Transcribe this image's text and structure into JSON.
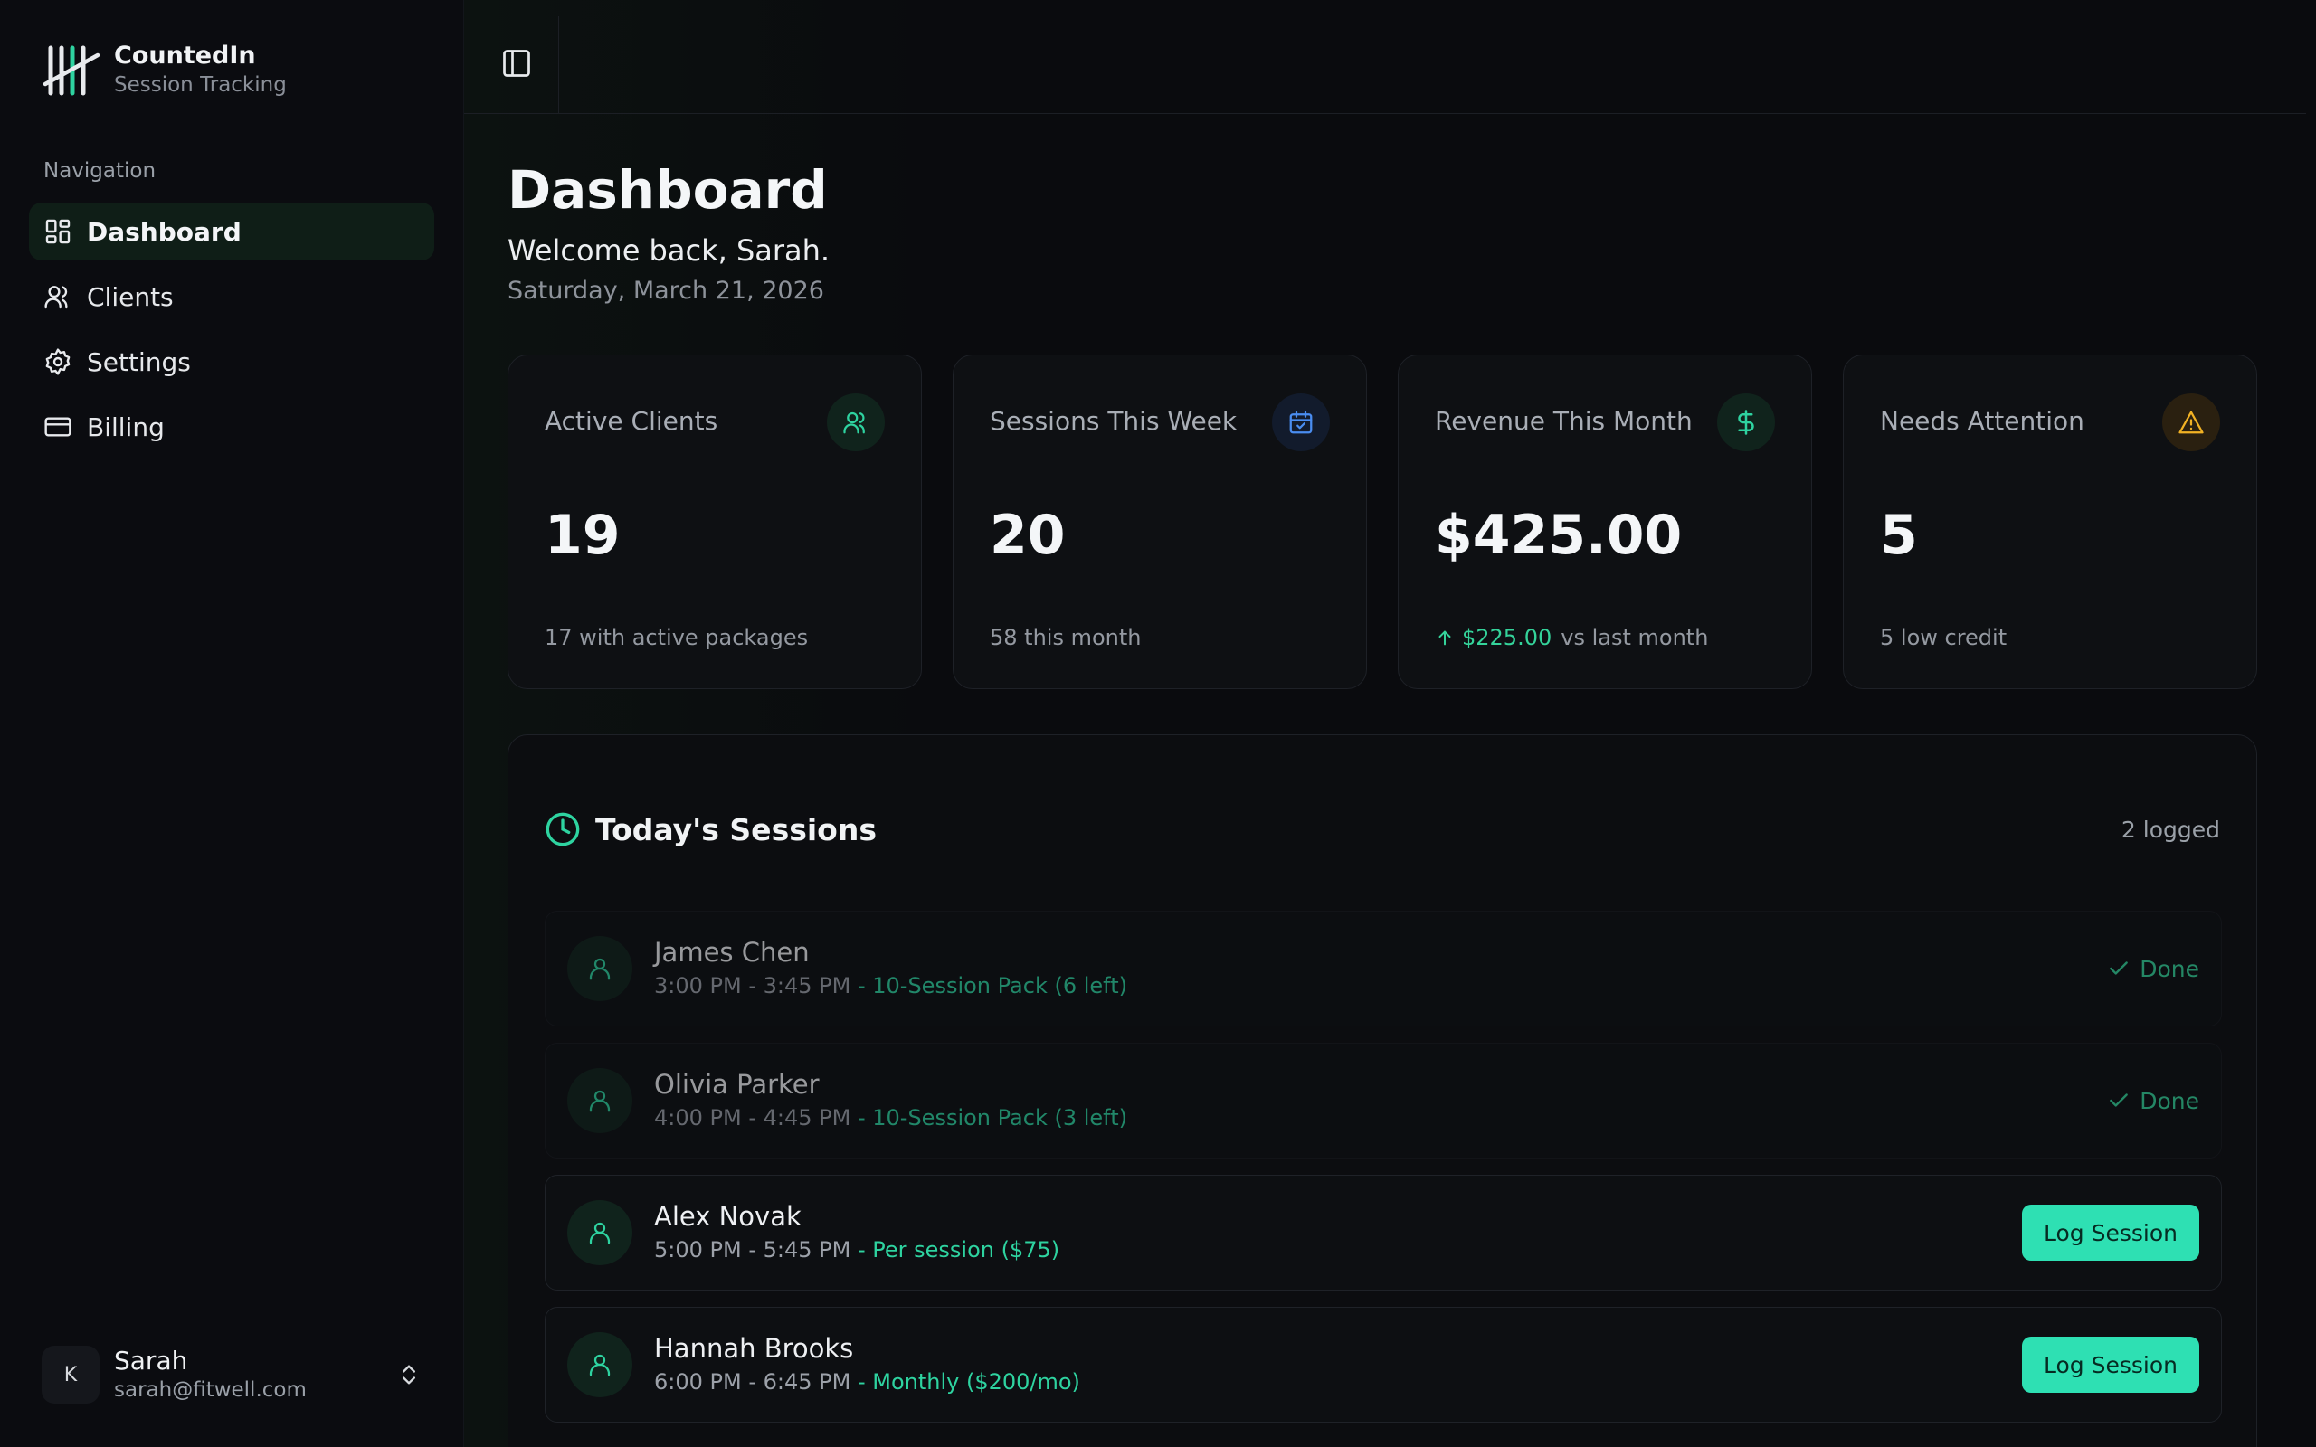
{
  "brand": {
    "name": "CountedIn",
    "subtitle": "Session Tracking"
  },
  "sidebar": {
    "section_label": "Navigation",
    "items": [
      {
        "label": "Dashboard",
        "icon": "dashboard-icon",
        "active": true
      },
      {
        "label": "Clients",
        "icon": "users-icon",
        "active": false
      },
      {
        "label": "Settings",
        "icon": "gear-icon",
        "active": false
      },
      {
        "label": "Billing",
        "icon": "credit-card-icon",
        "active": false
      }
    ],
    "user": {
      "initial": "K",
      "name": "Sarah",
      "email": "sarah@fitwell.com"
    }
  },
  "header": {
    "title": "Dashboard",
    "welcome": "Welcome back, Sarah.",
    "date": "Saturday, March 21, 2026"
  },
  "stats": [
    {
      "label": "Active Clients",
      "value": "19",
      "footer": "17 with active packages",
      "icon": "users-icon",
      "color": "#2ed3a0"
    },
    {
      "label": "Sessions This Week",
      "value": "20",
      "footer": "58 this month",
      "icon": "calendar-check-icon",
      "color": "#4a8df0"
    },
    {
      "label": "Revenue This Month",
      "value": "$425.00",
      "delta": "$225.00",
      "footer": "vs last month",
      "icon": "dollar-icon",
      "color": "#2ed3a0"
    },
    {
      "label": "Needs Attention",
      "value": "5",
      "footer": "5 low credit",
      "icon": "warning-icon",
      "color": "#f2b224"
    }
  ],
  "sessions": {
    "title": "Today's Sessions",
    "count": "2 logged",
    "done_label": "Done",
    "log_label": "Log Session",
    "rows": [
      {
        "name": "James Chen",
        "time": "3:00 PM - 3:45 PM",
        "package": " - 10-Session Pack (6 left)",
        "done": true
      },
      {
        "name": "Olivia Parker",
        "time": "4:00 PM - 4:45 PM",
        "package": " - 10-Session Pack (3 left)",
        "done": true
      },
      {
        "name": "Alex Novak",
        "time": "5:00 PM - 5:45 PM",
        "package": " - Per session ($75)",
        "done": false
      },
      {
        "name": "Hannah Brooks",
        "time": "6:00 PM - 6:45 PM",
        "package": " - Monthly ($200/mo)",
        "done": false
      }
    ]
  }
}
